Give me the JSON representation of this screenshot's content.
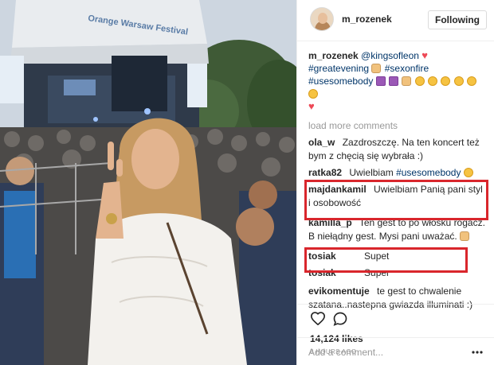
{
  "photo": {
    "stage_banner": "Orange Warsaw Festival"
  },
  "post": {
    "author": "m_rozenek",
    "follow_label": "Following",
    "caption": {
      "username": "m_rozenek",
      "mention": "@kingsofleon",
      "tag1": "#greatevening",
      "tag2": "#sexonfire",
      "tag3": "#usesomebody"
    },
    "load_more": "load more comments",
    "comments": [
      {
        "user": "ola_w",
        "text": "Zazdroszczę. Na ten koncert też bym z chęcią się wybrała :)"
      },
      {
        "user": "ratka82",
        "text": "Uwielbiam ",
        "tag": "#usesomebody"
      },
      {
        "user": "majdankamil",
        "text": "Uwielbiam Panią pani styl i osobowość"
      },
      {
        "user": "kamilla_p",
        "text": "Ten gest to po włosku rogacz. B niełądny gest. Mysi pani uważać."
      },
      {
        "user": "tosiak",
        "text": "Supet"
      },
      {
        "user": "tosiak",
        "text": "Super"
      },
      {
        "user": "evikomentuje",
        "text": "te gest to chwalenie szatana..nastepna gwiazda illuminati :)"
      }
    ],
    "likes": "14,124 likes",
    "time": "8 HOURS AGO",
    "add_comment_placeholder": "Add a comment..."
  },
  "colors": {
    "highlight_box": "#d9262c",
    "link_blue": "#003569",
    "heart": "#ed4956"
  },
  "icons": [
    "heart-outline-icon",
    "comment-icon",
    "more-options-icon"
  ]
}
